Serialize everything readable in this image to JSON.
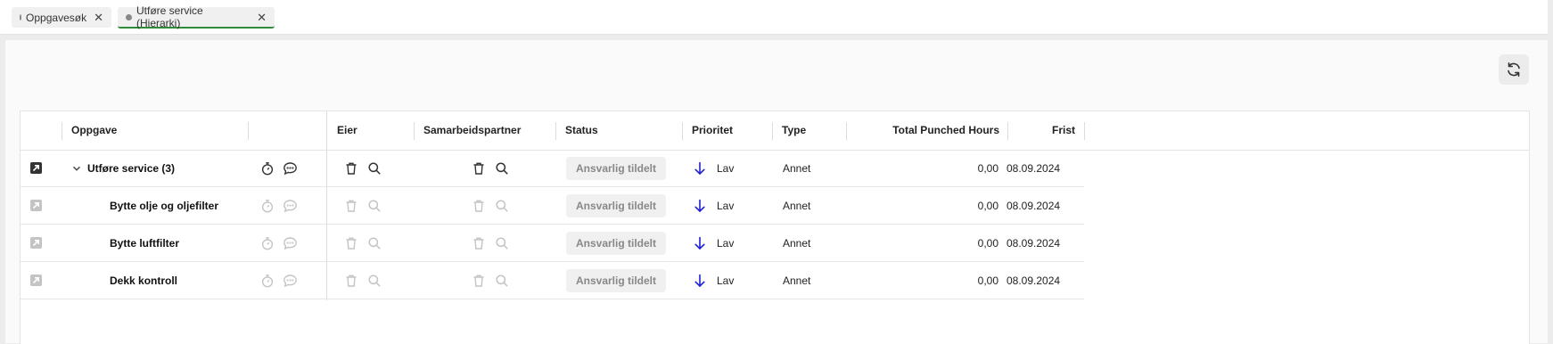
{
  "tabs": [
    {
      "label": "Oppgavesøk",
      "close": "✕"
    },
    {
      "label": "Utføre service (Hierarki)",
      "close": "✕"
    }
  ],
  "toolbar": {
    "refresh_icon": "refresh-icon"
  },
  "table": {
    "columns": {
      "task": "Oppgave",
      "owner": "Eier",
      "partner": "Samarbeidspartner",
      "status": "Status",
      "priority": "Prioritet",
      "type": "Type",
      "hours": "Total Punched Hours",
      "deadline": "Frist"
    },
    "rows": [
      {
        "task": "Utføre service (3)",
        "status": "Ansvarlig tildelt",
        "priority": "Lav",
        "type": "Annet",
        "hours": "0,00",
        "deadline": "08.09.2024"
      },
      {
        "task": "Bytte olje og oljefilter",
        "status": "Ansvarlig tildelt",
        "priority": "Lav",
        "type": "Annet",
        "hours": "0,00",
        "deadline": "08.09.2024"
      },
      {
        "task": "Bytte luftfilter",
        "status": "Ansvarlig tildelt",
        "priority": "Lav",
        "type": "Annet",
        "hours": "0,00",
        "deadline": "08.09.2024"
      },
      {
        "task": "Dekk kontroll",
        "status": "Ansvarlig tildelt",
        "priority": "Lav",
        "type": "Annet",
        "hours": "0,00",
        "deadline": "08.09.2024"
      }
    ]
  },
  "colors": {
    "accent_green": "#2e8b3a",
    "priority_arrow": "#2020d0",
    "dark_icon": "#333333",
    "dim_icon": "#c4c4c4"
  }
}
